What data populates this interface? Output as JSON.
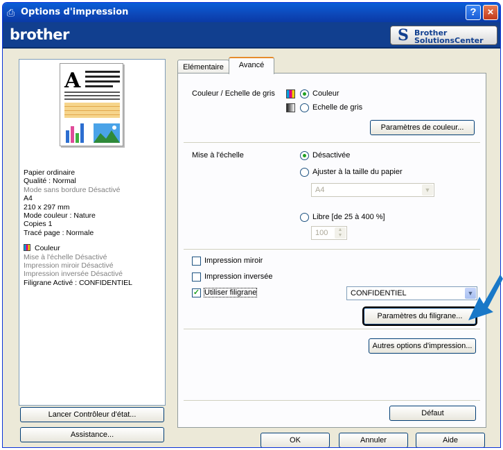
{
  "window": {
    "title": "Options d'impression",
    "help": "?",
    "close": "×"
  },
  "brand": {
    "logo": "brother",
    "solutions_line1": "Brother",
    "solutions_line2": "SolutionsCenter"
  },
  "summary": {
    "lines": [
      {
        "text": "Papier ordinaire",
        "dim": false
      },
      {
        "text": "Qualité : Normal",
        "dim": false
      },
      {
        "text": "Mode sans bordure Désactivé",
        "dim": true
      },
      {
        "text": "A4",
        "dim": false
      },
      {
        "text": "210 x 297 mm",
        "dim": false
      },
      {
        "text": "Mode couleur : Nature",
        "dim": false
      },
      {
        "text": "Copies 1",
        "dim": false
      },
      {
        "text": "Tracé page : Normale",
        "dim": false
      }
    ],
    "color_label": "Couleur",
    "lines2": [
      {
        "text": "Mise à l'échelle Désactivé",
        "dim": true
      },
      {
        "text": "Impression miroir Désactivé",
        "dim": true
      },
      {
        "text": "Impression inversée Désactivé",
        "dim": true
      },
      {
        "text": "Filigrane Activé : CONFIDENTIEL",
        "dim": false
      }
    ]
  },
  "left_buttons": {
    "status_monitor": "Lancer Contrôleur d'état...",
    "support": "Assistance..."
  },
  "tabs": [
    {
      "label": "Elémentaire",
      "active": false
    },
    {
      "label": "Avancé",
      "active": true
    }
  ],
  "color": {
    "label": "Couleur / Echelle de gris",
    "opt_color": "Couleur",
    "opt_gray": "Echelle de gris",
    "settings_button": "Paramètres de couleur..."
  },
  "scaling": {
    "label": "Mise à l'échelle",
    "opt_off": "Désactivée",
    "opt_fit": "Ajuster à la taille du papier",
    "paper_value": "A4",
    "opt_free": "Libre [de 25 à 400 %]",
    "free_value": "100"
  },
  "checks": {
    "mirror": {
      "label": "Impression miroir",
      "checked": false
    },
    "reverse": {
      "label": "Impression inversée",
      "checked": false
    },
    "watermark": {
      "label": "Utiliser filigrane",
      "checked": true
    }
  },
  "watermark": {
    "selected": "CONFIDENTIEL",
    "settings_button": "Paramètres du filigrane..."
  },
  "other_button": "Autres options d'impression...",
  "default_button": "Défaut",
  "dialog_buttons": {
    "ok": "OK",
    "cancel": "Annuler",
    "help": "Aide"
  },
  "colors": {
    "title_bar": "#0a5fd8",
    "brand_bar": "#113f8f",
    "active_tab": "#e68b2c",
    "callout_arrow": "#1978c8"
  }
}
